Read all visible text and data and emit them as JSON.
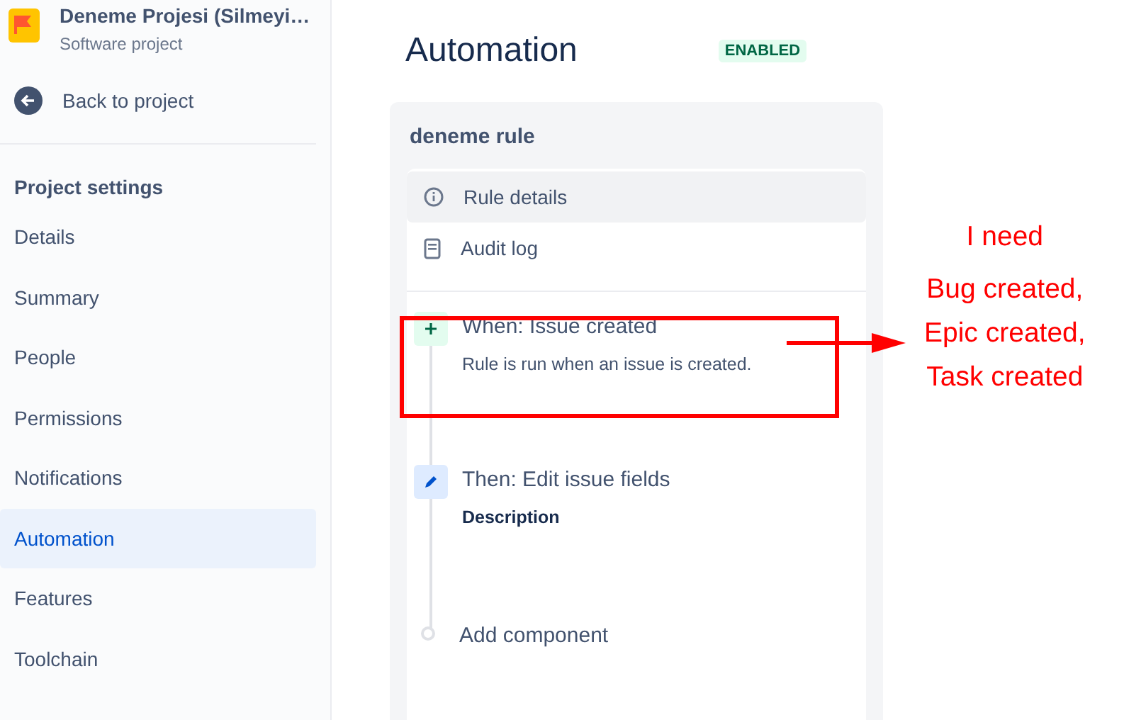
{
  "project": {
    "name": "Deneme Projesi (Silmeyi…",
    "type": "Software project"
  },
  "back_link": "Back to project",
  "sidebar": {
    "heading": "Project settings",
    "items": [
      {
        "label": "Details",
        "selected": false
      },
      {
        "label": "Summary",
        "selected": false
      },
      {
        "label": "People",
        "selected": false
      },
      {
        "label": "Permissions",
        "selected": false
      },
      {
        "label": "Notifications",
        "selected": false
      },
      {
        "label": "Automation",
        "selected": true
      },
      {
        "label": "Features",
        "selected": false
      },
      {
        "label": "Toolchain",
        "selected": false
      }
    ]
  },
  "page": {
    "title": "Automation",
    "status": "ENABLED"
  },
  "rule": {
    "name": "deneme rule",
    "menu": [
      {
        "kind": "info",
        "label": "Rule details",
        "selected": true
      },
      {
        "kind": "log",
        "label": "Audit log",
        "selected": false
      }
    ],
    "steps": [
      {
        "kind": "trigger",
        "title": "When: Issue created",
        "detail": "Rule is run when an issue is created."
      },
      {
        "kind": "action",
        "title": "Then: Edit issue fields",
        "detail": "Description"
      },
      {
        "kind": "add",
        "title": "Add component"
      }
    ]
  },
  "annotation": {
    "lines": [
      "I need",
      "Bug created,",
      "Epic created,",
      "Task created"
    ]
  }
}
